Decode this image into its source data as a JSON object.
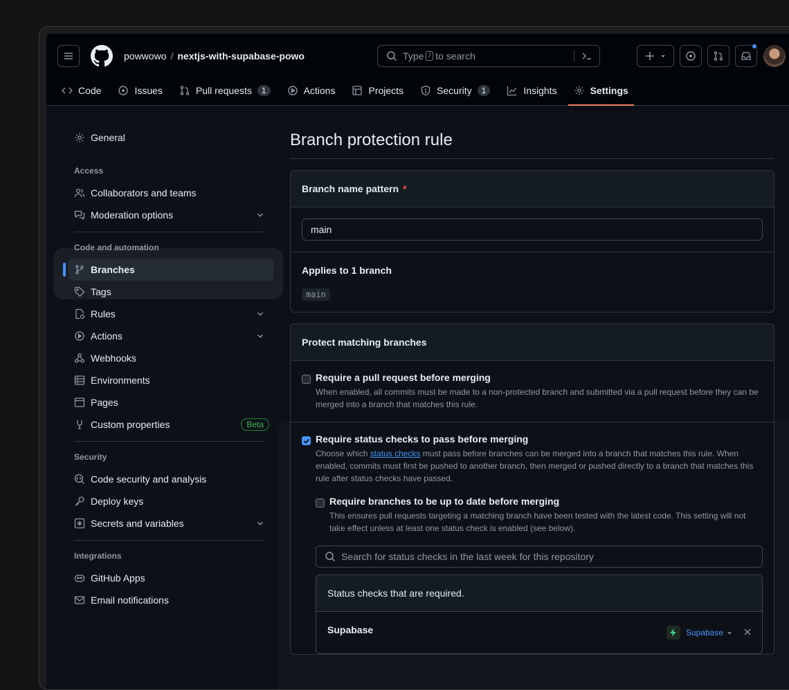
{
  "header": {
    "owner": "powwowo",
    "separator": "/",
    "repo": "nextjs-with-supabase-powo",
    "search_prefix": "Type",
    "search_key": "/",
    "search_suffix": "to search"
  },
  "tabs": [
    {
      "label": "Code",
      "icon": "code-icon"
    },
    {
      "label": "Issues",
      "icon": "issue-icon"
    },
    {
      "label": "Pull requests",
      "icon": "pull-request-icon",
      "count": "1"
    },
    {
      "label": "Actions",
      "icon": "play-icon"
    },
    {
      "label": "Projects",
      "icon": "table-icon"
    },
    {
      "label": "Security",
      "icon": "shield-icon",
      "count": "1"
    },
    {
      "label": "Insights",
      "icon": "graph-icon"
    },
    {
      "label": "Settings",
      "icon": "gear-icon",
      "active": true
    }
  ],
  "sidebar": {
    "general": "General",
    "access_heading": "Access",
    "collaborators": "Collaborators and teams",
    "moderation": "Moderation options",
    "code_heading": "Code and automation",
    "branches": "Branches",
    "tags": "Tags",
    "rules": "Rules",
    "actions": "Actions",
    "webhooks": "Webhooks",
    "environments": "Environments",
    "pages": "Pages",
    "custom_properties": "Custom properties",
    "beta": "Beta",
    "security_heading": "Security",
    "code_security": "Code security and analysis",
    "deploy_keys": "Deploy keys",
    "secrets": "Secrets and variables",
    "integrations_heading": "Integrations",
    "github_apps": "GitHub Apps",
    "email_notifications": "Email notifications"
  },
  "main": {
    "title": "Branch protection rule",
    "pattern_label": "Branch name pattern",
    "required_mark": "*",
    "pattern_value": "main",
    "applies_label": "Applies to 1 branch",
    "applies_branch": "main",
    "protect_heading": "Protect matching branches",
    "pr_title": "Require a pull request before merging",
    "pr_desc": "When enabled, all commits must be made to a non-protected branch and submitted via a pull request before they can be merged into a branch that matches this rule.",
    "status_title": "Require status checks to pass before merging",
    "status_desc_pre": "Choose which",
    "status_desc_link": "status checks",
    "status_desc_post": "must pass before branches can be merged into a branch that matches this rule. When enabled, commits must first be pushed to another branch, then merged or pushed directly to a branch that matches this rule after status checks have passed.",
    "uptodate_title": "Require branches to be up to date before merging",
    "uptodate_desc": "This ensures pull requests targeting a matching branch have been tested with the latest code. This setting will not take effect unless at least one status check is enabled (see below).",
    "search_placeholder": "Search for status checks in the last week for this repository",
    "required_checks_header": "Status checks that are required.",
    "check_name": "Supabase",
    "check_app": "Supabase"
  }
}
